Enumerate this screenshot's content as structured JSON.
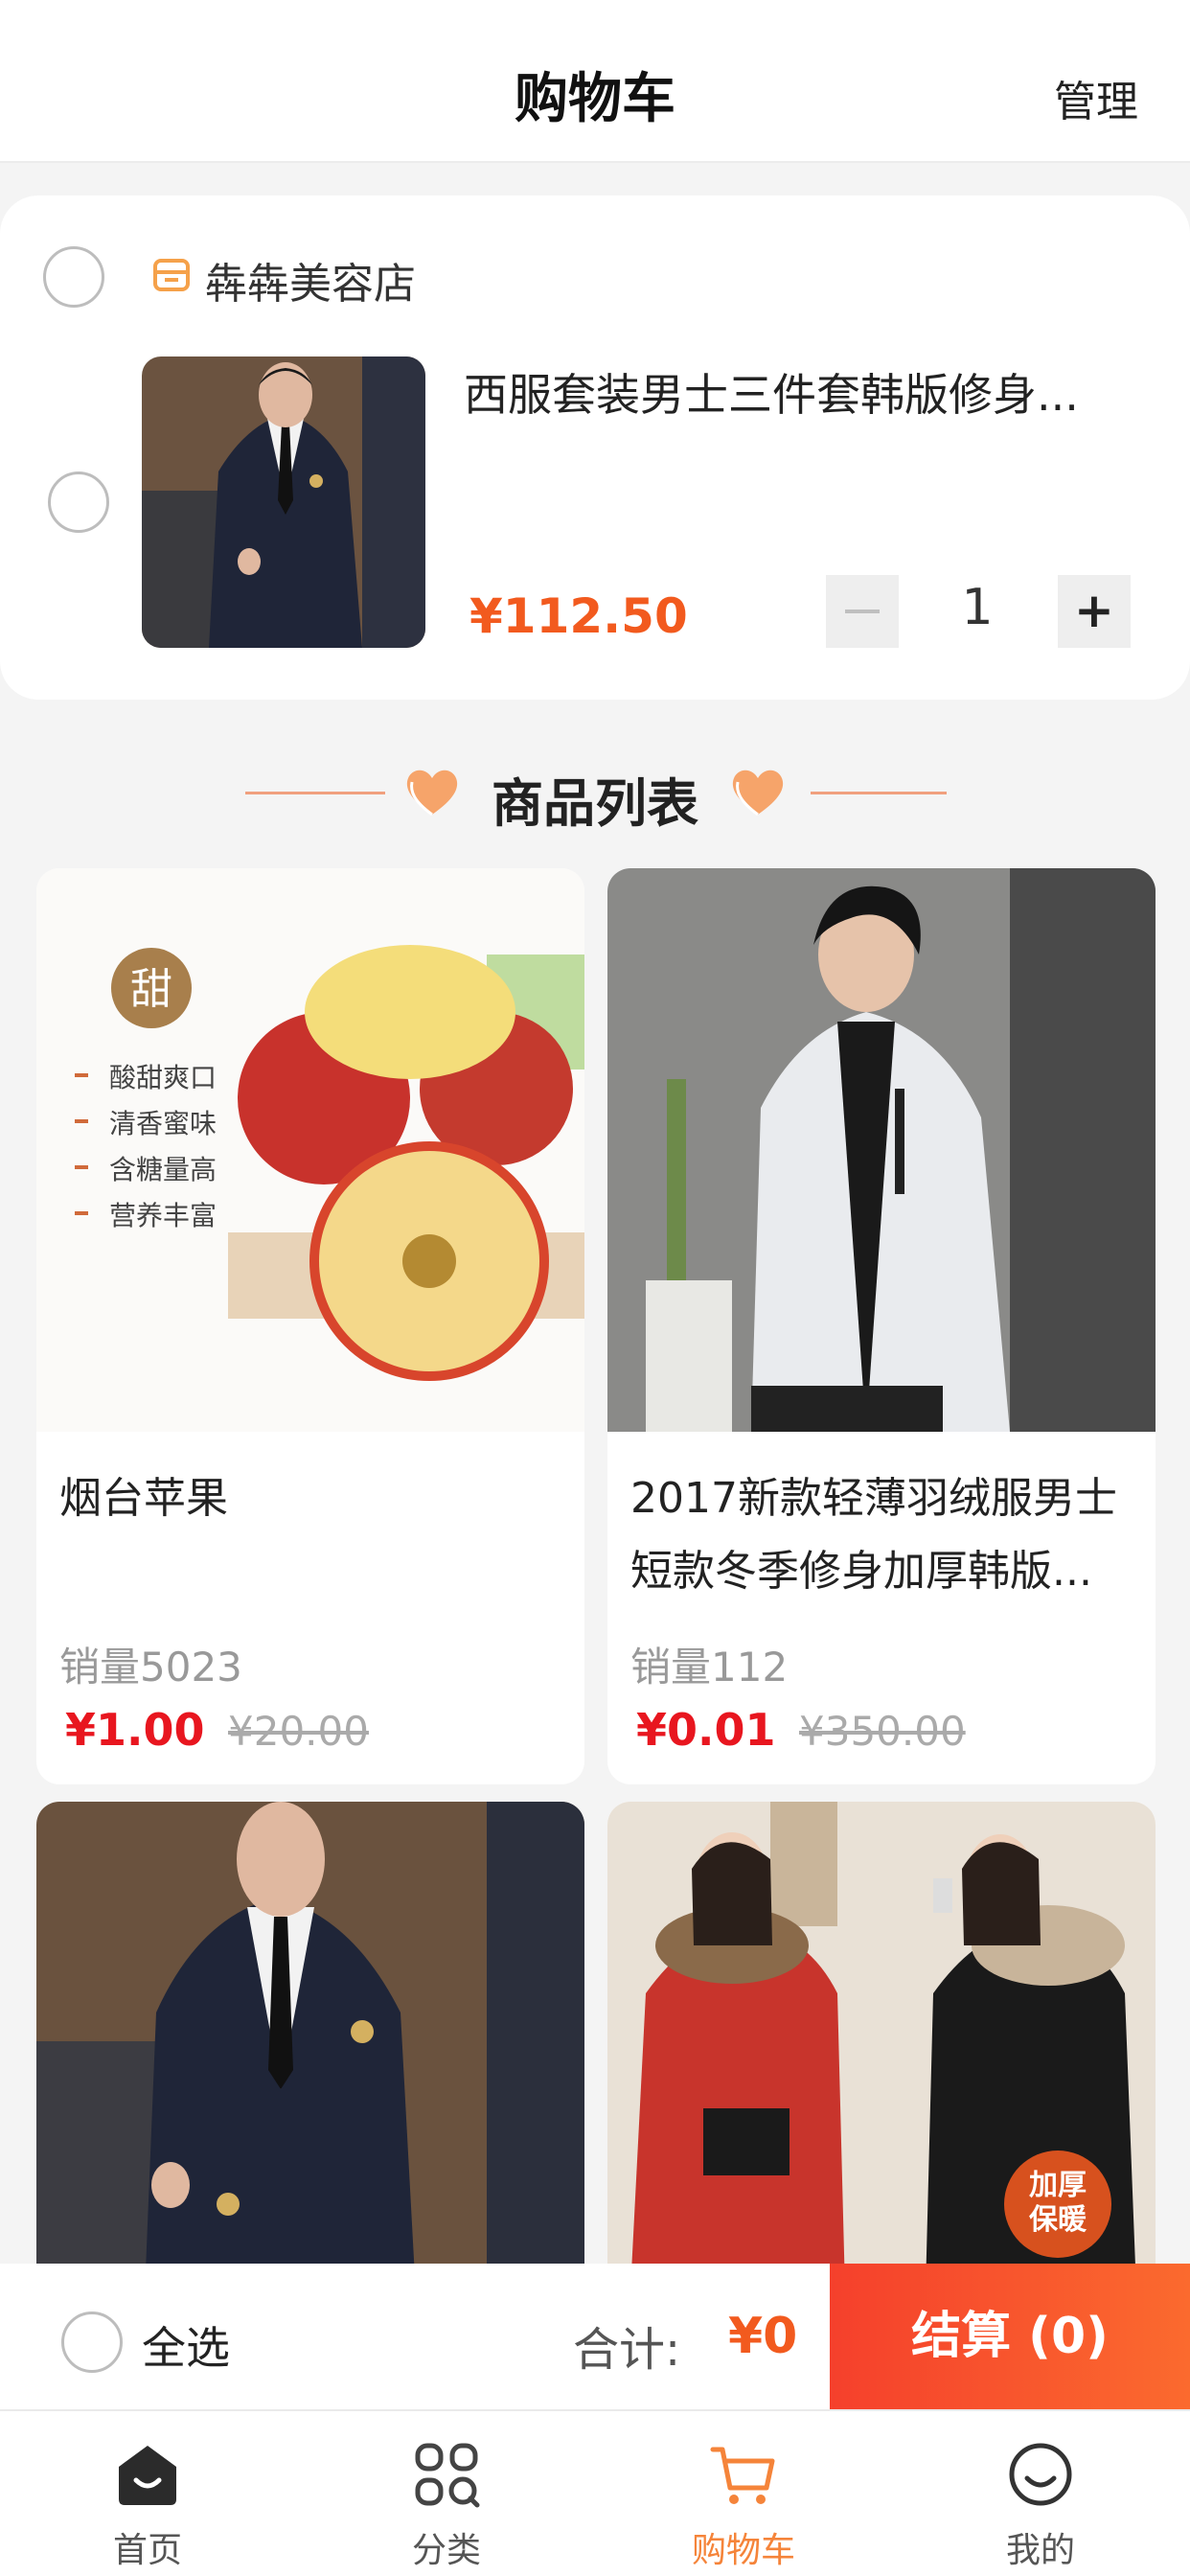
{
  "header": {
    "title": "购物车",
    "manage_label": "管理"
  },
  "cart": {
    "store_name": "犇犇美容店",
    "item": {
      "title": "西服套装男士三件套韩版修身...",
      "price": "¥112.50",
      "quantity": "1",
      "minus": "−",
      "plus": "+"
    }
  },
  "section": {
    "title": "商品列表"
  },
  "products": [
    {
      "name": "烟台苹果",
      "sales": "销量5023",
      "price": "¥1.00",
      "original_price": "¥20.00"
    },
    {
      "name": "2017新款轻薄羽绒服男士短款冬季修身加厚韩版...",
      "sales": "销量112",
      "price": "¥0.01",
      "original_price": "¥350.00"
    },
    {
      "name": "",
      "sales": "",
      "price": "",
      "original_price": ""
    },
    {
      "name": "",
      "sales": "",
      "price": "",
      "original_price": ""
    }
  ],
  "apple_tags": {
    "badge": "甜",
    "lines": [
      "酸甜爽口",
      "清香蜜味",
      "含糖量高",
      "营养丰富"
    ]
  },
  "coat_badge": {
    "line1": "加厚",
    "line2": "保暖"
  },
  "checkout": {
    "select_all": "全选",
    "total_label": "合计:",
    "total_value": "¥0",
    "pay_button": "结算 (0)"
  },
  "tabs": [
    {
      "label": "首页",
      "icon": "home-icon"
    },
    {
      "label": "分类",
      "icon": "category-icon"
    },
    {
      "label": "购物车",
      "icon": "cart-icon",
      "active": true
    },
    {
      "label": "我的",
      "icon": "profile-icon"
    }
  ],
  "colors": {
    "accent": "#f5843a",
    "price_orange": "#f25a1e",
    "price_red": "#e8161f",
    "pay_button": "#f5402c"
  }
}
